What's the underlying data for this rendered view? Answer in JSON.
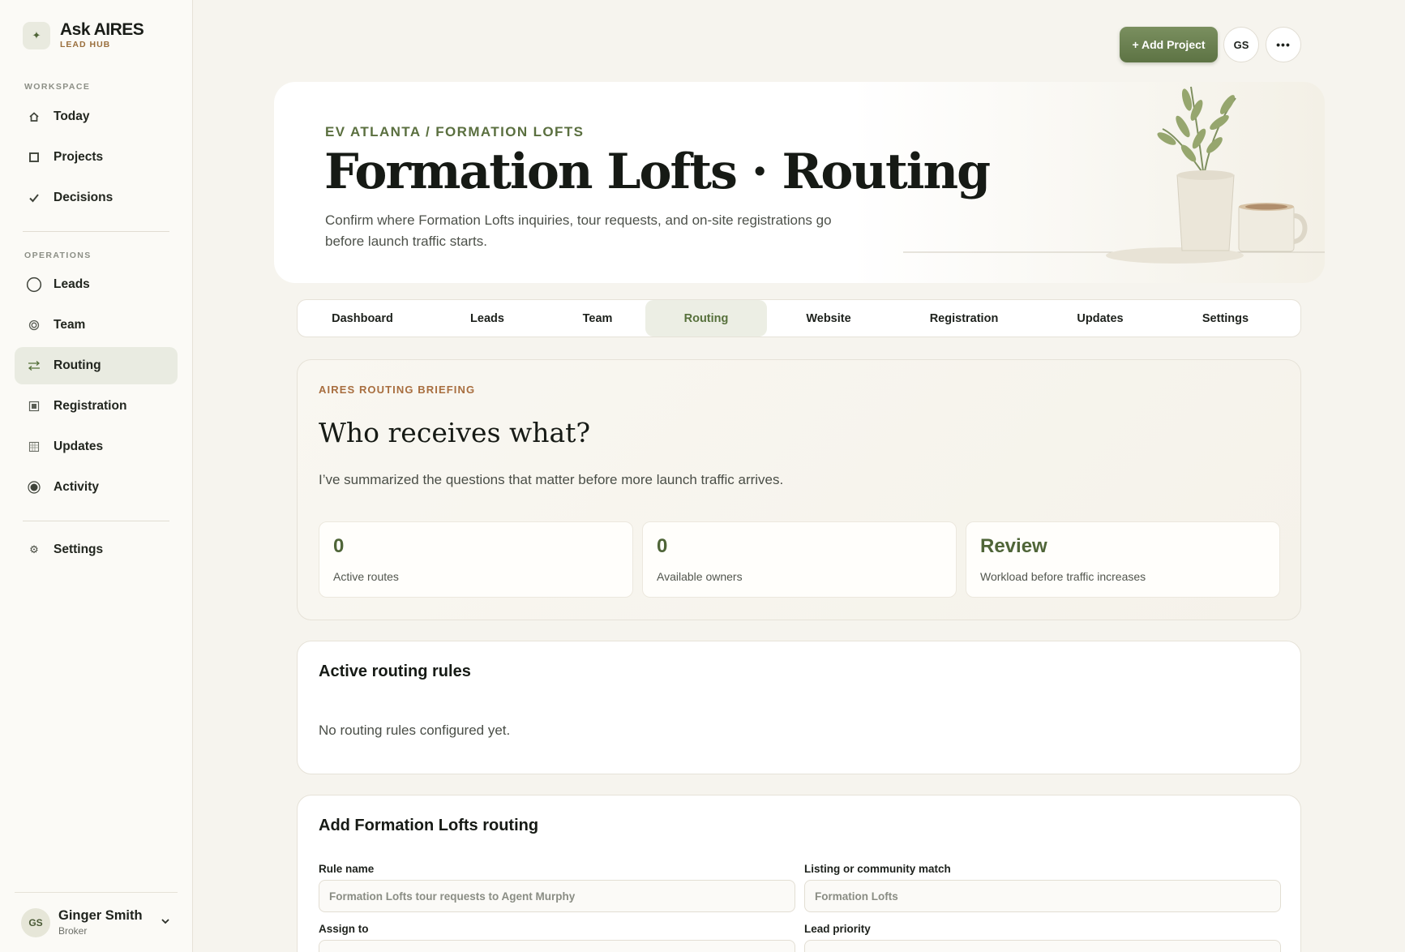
{
  "brand": {
    "title": "Ask AIRES",
    "subtitle": "LEAD HUB"
  },
  "sidebar": {
    "workspace_label": "WORKSPACE",
    "workspace_items": [
      {
        "label": "Today",
        "icon": "home-icon"
      },
      {
        "label": "Projects",
        "icon": "square-icon"
      },
      {
        "label": "Decisions",
        "icon": "check-icon"
      }
    ],
    "operations_label": "OPERATIONS",
    "operations_items": [
      {
        "label": "Leads",
        "icon": "circle-icon"
      },
      {
        "label": "Team",
        "icon": "target-icon"
      },
      {
        "label": "Routing",
        "icon": "arrows-icon",
        "active": true
      },
      {
        "label": "Registration",
        "icon": "form-icon"
      },
      {
        "label": "Updates",
        "icon": "grid-icon"
      },
      {
        "label": "Activity",
        "icon": "radio-icon"
      }
    ],
    "settings_label": "Settings",
    "user": {
      "initials": "GS",
      "name": "Ginger Smith",
      "role": "Broker"
    }
  },
  "topbar": {
    "add_project_label": "+ Add Project",
    "avatar_initials": "GS",
    "more_label": "•••"
  },
  "hero": {
    "eyebrow": "EV ATLANTA / FORMATION LOFTS",
    "title": "Formation Lofts · Routing",
    "description": "Confirm where Formation Lofts inquiries, tour requests, and on-site registrations go before launch traffic starts."
  },
  "tabs": [
    {
      "label": "Dashboard"
    },
    {
      "label": "Leads"
    },
    {
      "label": "Team"
    },
    {
      "label": "Routing",
      "active": true
    },
    {
      "label": "Website"
    },
    {
      "label": "Registration"
    },
    {
      "label": "Updates"
    },
    {
      "label": "Settings"
    }
  ],
  "briefing": {
    "eyebrow": "AIRES ROUTING BRIEFING",
    "title": "Who receives what?",
    "description": "I’ve summarized the questions that matter before more launch traffic arrives.",
    "stats": [
      {
        "value": "0",
        "label": "Active routes"
      },
      {
        "value": "0",
        "label": "Available owners"
      },
      {
        "value": "Review",
        "label": "Workload before traffic increases"
      }
    ]
  },
  "rules": {
    "title": "Active routing rules",
    "empty": "No routing rules configured yet."
  },
  "add_form": {
    "title": "Add Formation Lofts routing",
    "rule_name_label": "Rule name",
    "rule_name_placeholder": "Formation Lofts tour requests to Agent Murphy",
    "listing_label": "Listing or community match",
    "listing_placeholder": "Formation Lofts",
    "assign_label": "Assign to",
    "priority_label": "Lead priority"
  },
  "colors": {
    "accent": "#5d7344",
    "eyebrow_brown": "#a86e3f",
    "background": "#f6f4ee"
  }
}
